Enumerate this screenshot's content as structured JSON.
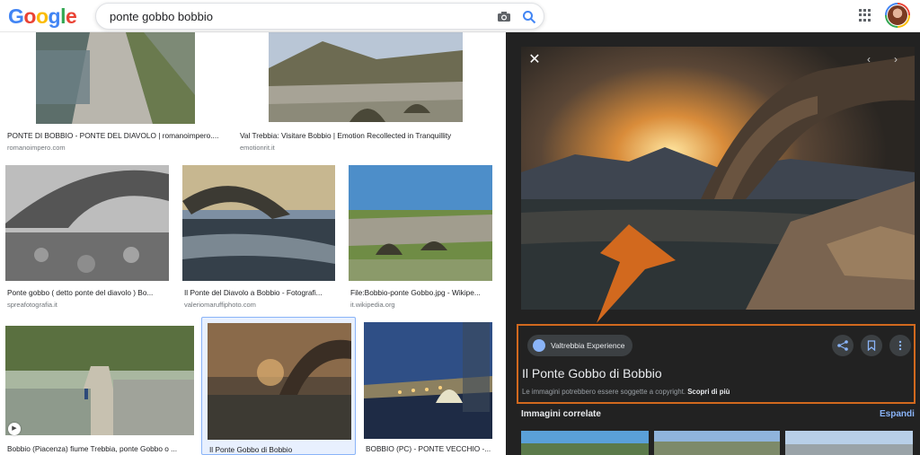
{
  "header": {
    "logo_letters": [
      "G",
      "o",
      "o",
      "g",
      "l",
      "e"
    ],
    "search_value": "ponte gobbo bobbio"
  },
  "results": [
    {
      "caption": "PONTE DI BOBBIO - PONTE DEL DIAVOLO | romanoimpero....",
      "source": "romanoimpero.com"
    },
    {
      "caption": "Val Trebbia: Visitare Bobbio | Emotion Recollected in Tranquillity",
      "source": "emotionrit.it"
    },
    {
      "caption": "Ponte gobbo ( detto ponte del diavolo ) Bo...",
      "source": "spreafotografia.it"
    },
    {
      "caption": "Il Ponte del Diavolo a Bobbio - Fotografi...",
      "source": "valeriomaruffiphoto.com"
    },
    {
      "caption": "File:Bobbio-ponte Gobbo.jpg - Wikipe...",
      "source": "it.wikipedia.org"
    },
    {
      "caption": "Bobbio (Piacenza) fiume Trebbia, ponte Gobbo o ...",
      "source": ""
    },
    {
      "caption": "Il Ponte Gobbo di Bobbio",
      "source": ""
    },
    {
      "caption": "BOBBIO (PC) - PONTE VECCHIO -...",
      "source": ""
    }
  ],
  "panel": {
    "chip_label": "Valtrebbia Experience",
    "title": "Il Ponte Gobbo di Bobbio",
    "copyright_note": "Le immagini potrebbero essere soggette a copyright.",
    "learn_more": "Scopri di più",
    "related_label": "Immagini correlate",
    "expand_label": "Espandi"
  },
  "colors": {
    "accent_blue": "#4285f4",
    "panel_bg": "#222222",
    "highlight_orange": "#d2691e"
  }
}
